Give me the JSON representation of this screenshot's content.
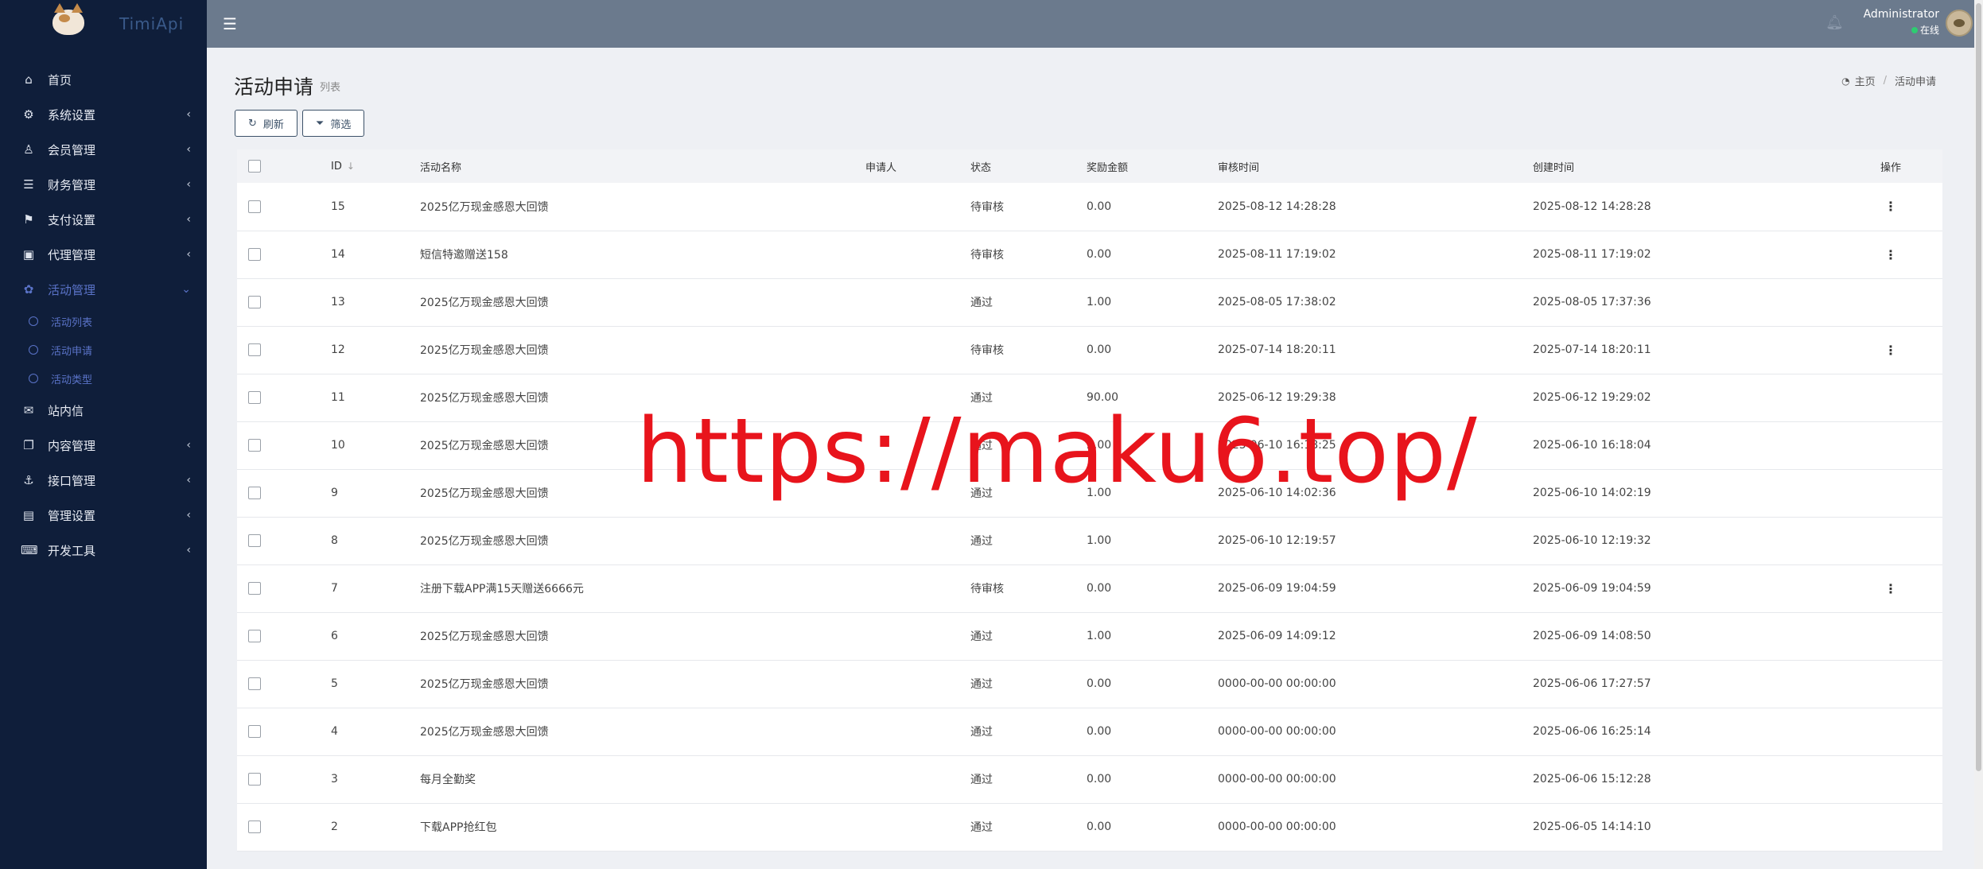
{
  "brand": {
    "name": "TimiApi"
  },
  "sidebar": {
    "items": [
      {
        "label": "首页",
        "icon": "home-icon",
        "glyph": "⌂",
        "expand": ""
      },
      {
        "label": "系统设置",
        "icon": "cogs-icon",
        "glyph": "⚙",
        "expand": "‹"
      },
      {
        "label": "会员管理",
        "icon": "user-icon",
        "glyph": "♙",
        "expand": "‹"
      },
      {
        "label": "财务管理",
        "icon": "database-icon",
        "glyph": "☰",
        "expand": "‹"
      },
      {
        "label": "支付设置",
        "icon": "bookmark-icon",
        "glyph": "⚑",
        "expand": "‹"
      },
      {
        "label": "代理管理",
        "icon": "contact-card-icon",
        "glyph": "▣",
        "expand": "‹"
      },
      {
        "label": "活动管理",
        "icon": "activity-icon",
        "glyph": "✿",
        "expand": "⌄"
      }
    ],
    "sub_items": [
      {
        "label": "活动列表"
      },
      {
        "label": "活动申请"
      },
      {
        "label": "活动类型"
      }
    ],
    "items_after": [
      {
        "label": "站内信",
        "icon": "envelope-icon",
        "glyph": "✉",
        "expand": ""
      },
      {
        "label": "内容管理",
        "icon": "copy-icon",
        "glyph": "❐",
        "expand": "‹"
      },
      {
        "label": "接口管理",
        "icon": "anchor-icon",
        "glyph": "⚓",
        "expand": "‹"
      },
      {
        "label": "管理设置",
        "icon": "id-card-icon",
        "glyph": "▤",
        "expand": "‹"
      },
      {
        "label": "开发工具",
        "icon": "keyboard-icon",
        "glyph": "⌨",
        "expand": "‹"
      }
    ]
  },
  "header": {
    "user_name": "Administrator",
    "user_status": "在线"
  },
  "page": {
    "title": "活动申请",
    "subtitle": "列表",
    "breadcrumb_home": "主页",
    "breadcrumb_current": "活动申请"
  },
  "toolbar": {
    "refresh_label": "刷新",
    "filter_label": "筛选"
  },
  "table": {
    "headers": {
      "id": "ID",
      "name": "活动名称",
      "applicant": "申请人",
      "status": "状态",
      "amount": "奖励金额",
      "review_time": "审核时间",
      "created_time": "创建时间",
      "actions": "操作"
    },
    "rows": [
      {
        "id": "15",
        "name": "2025亿万现金感恩大回馈",
        "applicant": "",
        "status": "待审核",
        "amount": "0.00",
        "review_time": "2025-08-12 14:28:28",
        "created_time": "2025-08-12 14:28:28",
        "action": "⋮"
      },
      {
        "id": "14",
        "name": "短信特邀赠送158",
        "applicant": "",
        "status": "待审核",
        "amount": "0.00",
        "review_time": "2025-08-11 17:19:02",
        "created_time": "2025-08-11 17:19:02",
        "action": "⋮"
      },
      {
        "id": "13",
        "name": "2025亿万现金感恩大回馈",
        "applicant": "",
        "status": "通过",
        "amount": "1.00",
        "review_time": "2025-08-05 17:38:02",
        "created_time": "2025-08-05 17:37:36",
        "action": ""
      },
      {
        "id": "12",
        "name": "2025亿万现金感恩大回馈",
        "applicant": "",
        "status": "待审核",
        "amount": "0.00",
        "review_time": "2025-07-14 18:20:11",
        "created_time": "2025-07-14 18:20:11",
        "action": "⋮"
      },
      {
        "id": "11",
        "name": "2025亿万现金感恩大回馈",
        "applicant": "",
        "status": "通过",
        "amount": "90.00",
        "review_time": "2025-06-12 19:29:38",
        "created_time": "2025-06-12 19:29:02",
        "action": ""
      },
      {
        "id": "10",
        "name": "2025亿万现金感恩大回馈",
        "applicant": "",
        "status": "通过",
        "amount": "2.00",
        "review_time": "2025-06-10 16:18:25",
        "created_time": "2025-06-10 16:18:04",
        "action": ""
      },
      {
        "id": "9",
        "name": "2025亿万现金感恩大回馈",
        "applicant": "",
        "status": "通过",
        "amount": "1.00",
        "review_time": "2025-06-10 14:02:36",
        "created_time": "2025-06-10 14:02:19",
        "action": ""
      },
      {
        "id": "8",
        "name": "2025亿万现金感恩大回馈",
        "applicant": "",
        "status": "通过",
        "amount": "1.00",
        "review_time": "2025-06-10 12:19:57",
        "created_time": "2025-06-10 12:19:32",
        "action": ""
      },
      {
        "id": "7",
        "name": "注册下载APP满15天赠送6666元",
        "applicant": "",
        "status": "待审核",
        "amount": "0.00",
        "review_time": "2025-06-09 19:04:59",
        "created_time": "2025-06-09 19:04:59",
        "action": "⋮"
      },
      {
        "id": "6",
        "name": "2025亿万现金感恩大回馈",
        "applicant": "",
        "status": "通过",
        "amount": "1.00",
        "review_time": "2025-06-09 14:09:12",
        "created_time": "2025-06-09 14:08:50",
        "action": ""
      },
      {
        "id": "5",
        "name": "2025亿万现金感恩大回馈",
        "applicant": "",
        "status": "通过",
        "amount": "0.00",
        "review_time": "0000-00-00 00:00:00",
        "created_time": "2025-06-06 17:27:57",
        "action": ""
      },
      {
        "id": "4",
        "name": "2025亿万现金感恩大回馈",
        "applicant": "",
        "status": "通过",
        "amount": "0.00",
        "review_time": "0000-00-00 00:00:00",
        "created_time": "2025-06-06 16:25:14",
        "action": ""
      },
      {
        "id": "3",
        "name": "每月全勤奖",
        "applicant": "",
        "status": "通过",
        "amount": "0.00",
        "review_time": "0000-00-00 00:00:00",
        "created_time": "2025-06-06 15:12:28",
        "action": ""
      },
      {
        "id": "2",
        "name": "下载APP抢红包",
        "applicant": "",
        "status": "通过",
        "amount": "0.00",
        "review_time": "0000-00-00 00:00:00",
        "created_time": "2025-06-05 14:14:10",
        "action": ""
      }
    ]
  },
  "watermark": "https://maku6.top/"
}
